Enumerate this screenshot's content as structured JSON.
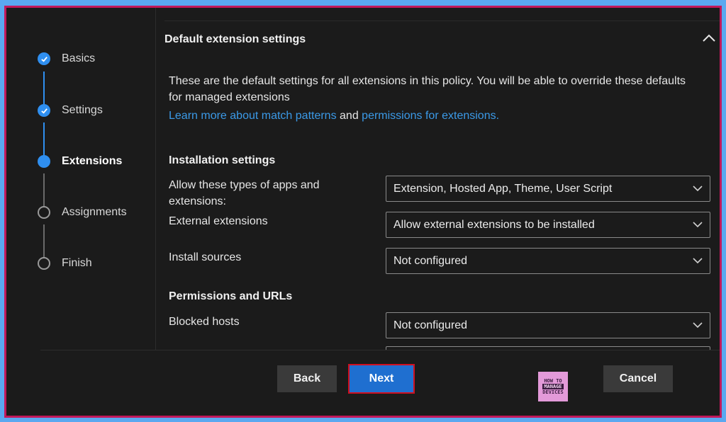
{
  "steps": [
    {
      "label": "Basics",
      "state": "done"
    },
    {
      "label": "Settings",
      "state": "done"
    },
    {
      "label": "Extensions",
      "state": "current"
    },
    {
      "label": "Assignments",
      "state": "todo"
    },
    {
      "label": "Finish",
      "state": "todo"
    }
  ],
  "section": {
    "title": "Default extension settings",
    "description": "These are the default settings for all extensions in this policy. You will be able to override these defaults for managed extensions",
    "link1": "Learn more about match patterns",
    "link_joiner": " and ",
    "link2": "permissions for extensions."
  },
  "installation": {
    "heading": "Installation settings",
    "allow_types_label": "Allow these types of apps and extensions:",
    "allow_types_value": "Extension, Hosted App, Theme, User Script",
    "external_label": "External extensions",
    "external_value": "Allow external extensions to be installed",
    "sources_label": "Install sources",
    "sources_value": "Not configured"
  },
  "permissions": {
    "heading": "Permissions and URLs",
    "blocked_hosts_label": "Blocked hosts",
    "blocked_hosts_value": "Not configured"
  },
  "footer": {
    "back_label": "Back",
    "next_label": "Next",
    "cancel_label": "Cancel"
  },
  "logo": {
    "line1": "HOW TO",
    "line2": "MANAGE",
    "line3": "DEVICES"
  },
  "colors": {
    "accent": "#2f8ff0",
    "link": "#3b9ae8",
    "next_outline": "#d01020",
    "frame_border": "#c2185b"
  }
}
